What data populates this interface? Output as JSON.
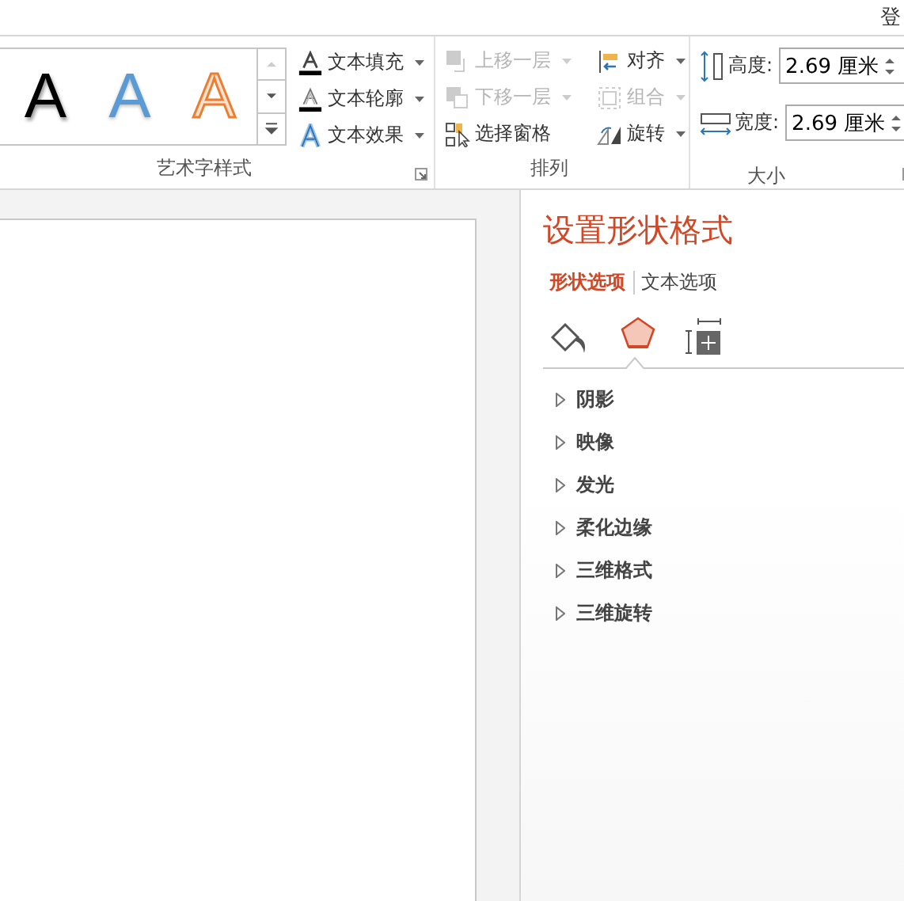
{
  "title_bar": {
    "text": "登"
  },
  "wordart_group": {
    "label": "艺术字样式",
    "samples": [
      {
        "text": "A",
        "kind": "black"
      },
      {
        "text": "A",
        "kind": "blue"
      },
      {
        "text": "A",
        "kind": "orange"
      }
    ],
    "commands": [
      {
        "label": "文本填充",
        "kind": "fill"
      },
      {
        "label": "文本轮廓",
        "kind": "outline"
      },
      {
        "label": "文本效果",
        "kind": "effects"
      }
    ]
  },
  "arrange_group": {
    "label": "排列",
    "columns": [
      [
        {
          "label": "上移一层",
          "kind": "forward",
          "disabled": true,
          "has_menu": true
        },
        {
          "label": "下移一层",
          "kind": "backward",
          "disabled": true,
          "has_menu": true
        },
        {
          "label": "选择窗格",
          "kind": "pane",
          "disabled": false,
          "has_menu": false
        }
      ],
      [
        {
          "label": "对齐",
          "kind": "align",
          "disabled": false,
          "has_menu": true
        },
        {
          "label": "组合",
          "kind": "group",
          "disabled": true,
          "has_menu": true
        },
        {
          "label": "旋转",
          "kind": "rotate",
          "disabled": false,
          "has_menu": true
        }
      ]
    ]
  },
  "size_group": {
    "label": "大小",
    "fields": [
      {
        "label": "高度:",
        "value": "2.69 厘米",
        "kind": "height"
      },
      {
        "label": "宽度:",
        "value": "2.69 厘米",
        "kind": "width"
      }
    ]
  },
  "format_pane": {
    "title": "设置形状格式",
    "tabs": [
      {
        "label": "形状选项",
        "selected": true
      },
      {
        "label": "文本选项",
        "selected": false
      }
    ],
    "icon_tabs": [
      {
        "kind": "fill",
        "selected": false
      },
      {
        "kind": "effects",
        "selected": true
      },
      {
        "kind": "size",
        "selected": false
      }
    ],
    "sections": [
      {
        "label": "阴影",
        "expanded": false
      },
      {
        "label": "映像",
        "expanded": false
      },
      {
        "label": "发光",
        "expanded": false
      },
      {
        "label": "柔化边缘",
        "expanded": false
      },
      {
        "label": "三维格式",
        "expanded": false
      },
      {
        "label": "三维旋转",
        "expanded": false
      }
    ]
  }
}
